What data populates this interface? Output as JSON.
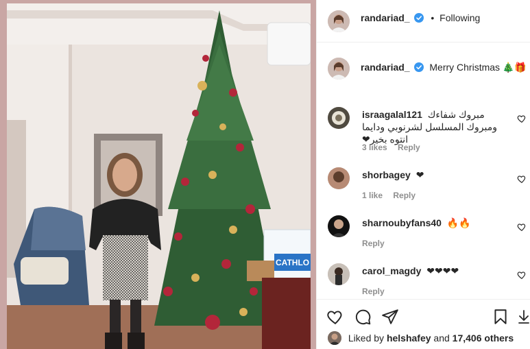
{
  "post": {
    "image_alt": "Woman in black sweater and houndstooth skirt standing beside a tall decorated Christmas tree"
  },
  "header": {
    "username": "randariad_",
    "separator": "•",
    "follow_status": "Following"
  },
  "caption": {
    "username": "randariad_",
    "text": "Merry Christmas 🎄🎁"
  },
  "comments": [
    {
      "username": "israagalal121",
      "text": "مبروك شفاءك ومبروك المسلسل لشرنوبي ودايما انتوه بخير❤",
      "likes": "3 likes",
      "reply": "Reply"
    },
    {
      "username": "shorbagey",
      "text": "❤",
      "likes": "1 like",
      "reply": "Reply"
    },
    {
      "username": "sharnoubyfans40",
      "text": "🔥🔥",
      "likes": "",
      "reply": "Reply"
    },
    {
      "username": "carol_magdy",
      "text": "❤❤❤❤",
      "likes": "",
      "reply": "Reply"
    }
  ],
  "actions": {
    "liked_by_prefix": "Liked by",
    "liked_by_user": "helshafey",
    "liked_by_and": "and",
    "liked_by_count": "17,406 others"
  },
  "icons": {
    "like": "heart-outline-icon",
    "comment": "comment-bubble-icon",
    "share": "paper-plane-icon",
    "save": "bookmark-icon",
    "download": "download-icon",
    "verified": "verified-badge-icon"
  },
  "colors": {
    "verified": "#3897f0",
    "meta_gray": "#8e8e8e",
    "text": "#262626"
  }
}
